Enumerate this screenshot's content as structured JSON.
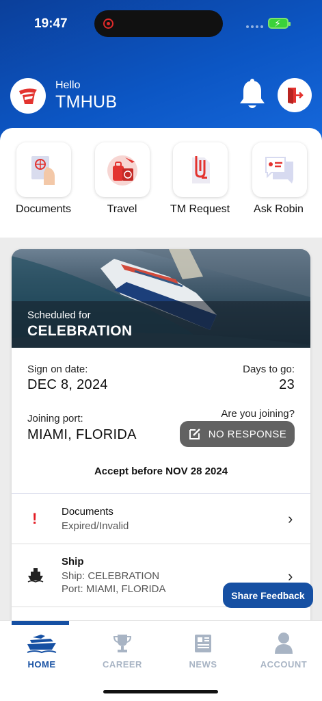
{
  "status": {
    "time": "19:47"
  },
  "header": {
    "greeting": "Hello",
    "username": "TMHUB"
  },
  "quick_actions": [
    {
      "label": "Documents"
    },
    {
      "label": "Travel"
    },
    {
      "label": "TM Request"
    },
    {
      "label": "Ask Robin"
    }
  ],
  "assignment": {
    "scheduled_label": "Scheduled for",
    "ship_name": "CELEBRATION",
    "sign_on_label": "Sign on date:",
    "sign_on_value": "DEC 8, 2024",
    "days_label": "Days to go:",
    "days_value": "23",
    "port_label": "Joining port:",
    "port_value": "MIAMI, FLORIDA",
    "joining_question": "Are you joining?",
    "response_button": "NO RESPONSE",
    "accept_note": "Accept before NOV 28 2024"
  },
  "rows": [
    {
      "title": "Documents",
      "lines": [
        "Expired/Invalid"
      ]
    },
    {
      "title": "Ship",
      "lines": [
        "Ship: CELEBRATION",
        "Port: MIAMI, FLORIDA"
      ]
    }
  ],
  "feedback_button": "Share Feedback",
  "tabs": [
    {
      "label": "HOME",
      "active": true
    },
    {
      "label": "CAREER",
      "active": false
    },
    {
      "label": "NEWS",
      "active": false
    },
    {
      "label": "ACCOUNT",
      "active": false
    }
  ],
  "colors": {
    "brand_blue": "#1650a3",
    "accent_red": "#e3332f",
    "inactive": "#a8b4c4"
  }
}
